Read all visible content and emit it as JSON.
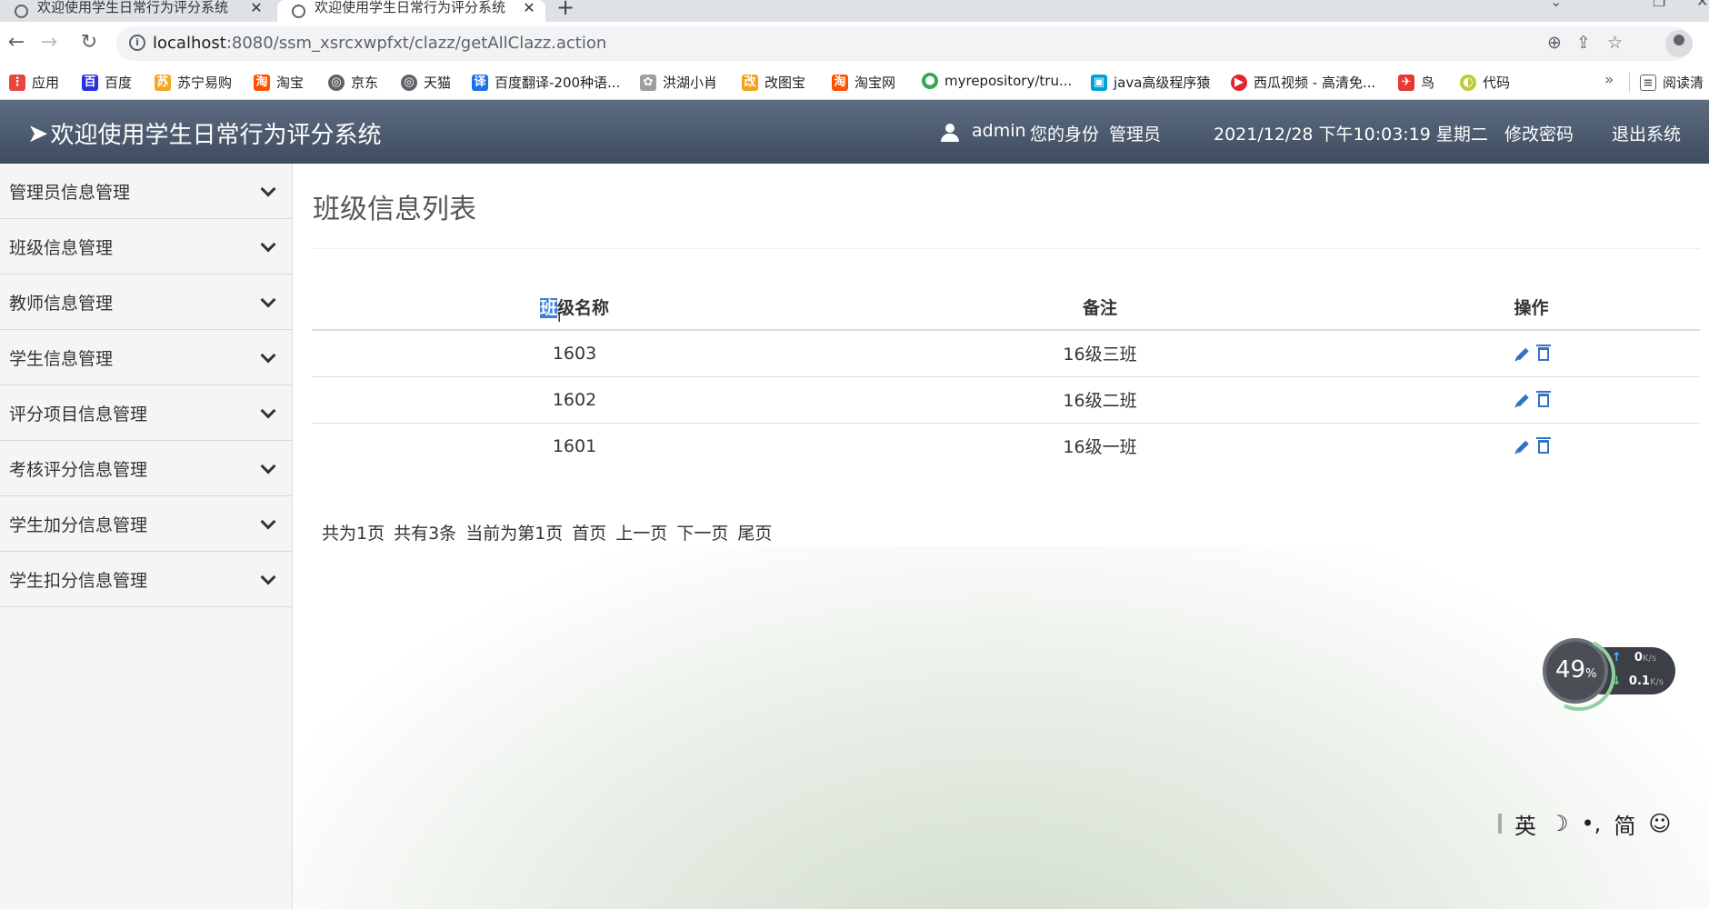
{
  "browser": {
    "tabs": [
      {
        "title": "欢迎使用学生日常行为评分系统",
        "close": "✕"
      },
      {
        "title": "欢迎使用学生日常行为评分系统",
        "close": "✕"
      }
    ],
    "new_tab": "+",
    "url_host": "localhost",
    "url_rest": ":8080/ssm_xsrcxwpfxt/clazz/getAllClazz.action",
    "bookmarks": [
      {
        "label": "应用",
        "icon": "apps-icon",
        "color": "#e8453c"
      },
      {
        "label": "百度",
        "icon": "baidu-icon",
        "color": "#2932e1"
      },
      {
        "label": "苏宁易购",
        "icon": "suning-icon",
        "color": "#f5a623"
      },
      {
        "label": "淘宝",
        "icon": "taobao-icon",
        "color": "#ff5000"
      },
      {
        "label": "京东",
        "icon": "globe-icon",
        "color": "#5f6368"
      },
      {
        "label": "天猫",
        "icon": "globe-icon",
        "color": "#5f6368"
      },
      {
        "label": "百度翻译-200种语...",
        "icon": "translate-icon",
        "color": "#1a73e8"
      },
      {
        "label": "洪湖小肖",
        "icon": "hongge-icon",
        "color": "#9e9e9e"
      },
      {
        "label": "改图宝",
        "icon": "gaitubao-icon",
        "color": "#f4a21c"
      },
      {
        "label": "淘宝网",
        "icon": "taobao-icon",
        "color": "#ff5000"
      },
      {
        "label": "myrepository/tru...",
        "icon": "chrome-icon",
        "color": "#34a853"
      },
      {
        "label": "java高级程序猿",
        "icon": "bilibili-icon",
        "color": "#00a1d6"
      },
      {
        "label": "西瓜视频 - 高清免...",
        "icon": "xigua-icon",
        "color": "#e5232c"
      },
      {
        "label": "鸟",
        "icon": "bird-icon",
        "color": "#e53935"
      },
      {
        "label": "代码",
        "icon": "code-icon",
        "color": "#c0ca33"
      }
    ],
    "more": "»",
    "reading_list": "阅读清"
  },
  "header": {
    "brand": "欢迎使用学生日常行为评分系统",
    "username": "admin",
    "role_label": "您的身份",
    "role": "管理员",
    "datetime": "2021/12/28 下午10:03:19 星期二",
    "change_password": "修改密码",
    "logout": "退出系统"
  },
  "sidebar": {
    "items": [
      {
        "label": "管理员信息管理"
      },
      {
        "label": "班级信息管理"
      },
      {
        "label": "教师信息管理"
      },
      {
        "label": "学生信息管理"
      },
      {
        "label": "评分项目信息管理"
      },
      {
        "label": "考核评分信息管理"
      },
      {
        "label": "学生加分信息管理"
      },
      {
        "label": "学生扣分信息管理"
      }
    ]
  },
  "main": {
    "title": "班级信息列表",
    "columns": {
      "col0_selected": "班",
      "col0_rest": "级名称",
      "col1": "备注",
      "col2": "操作"
    },
    "rows": [
      {
        "name": "1603",
        "remark": "16级三班"
      },
      {
        "name": "1602",
        "remark": "16级二班"
      },
      {
        "name": "1601",
        "remark": "16级一班"
      }
    ],
    "pager": {
      "total_pages": "共为1页",
      "total_records": "共有3条",
      "current": "当前为第1页",
      "first": "首页",
      "prev": "上一页",
      "next": "下一页",
      "last": "尾页"
    }
  },
  "speed_widget": {
    "percent": "49",
    "percent_sign": "%",
    "up": "0",
    "down": "0.1",
    "unit": "K/s"
  },
  "ime": {
    "lang": "英",
    "moon": "☽",
    "punct": "•,",
    "simp": "简",
    "emoji": "☺"
  }
}
